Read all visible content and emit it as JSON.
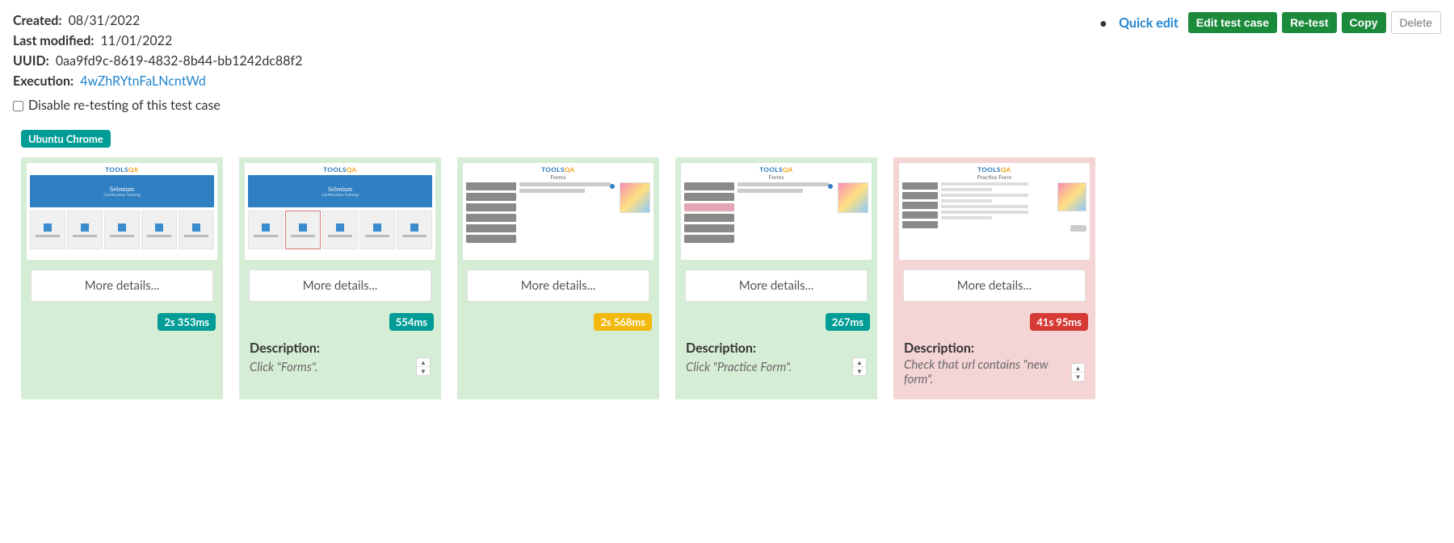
{
  "meta": {
    "created_label": "Created:",
    "created_value": "08/31/2022",
    "modified_label": "Last modified:",
    "modified_value": "11/01/2022",
    "uuid_label": "UUID:",
    "uuid_value": "0aa9fd9c-8619-4832-8b44-bb1242dc88f2",
    "execution_label": "Execution:",
    "execution_value": "4wZhRYtnFaLNcntWd",
    "disable_label": "Disable re-testing of this test case"
  },
  "actions": {
    "quick_edit": "Quick edit",
    "edit": "Edit test case",
    "retest": "Re-test",
    "copy": "Copy",
    "delete": "Delete"
  },
  "env_badge": "Ubuntu Chrome",
  "cards": [
    {
      "status": "green",
      "thumb_variant": "a",
      "thumb_active_tile": false,
      "more": "More details...",
      "time": "2s 353ms",
      "time_color": "teal",
      "has_desc": false
    },
    {
      "status": "green",
      "thumb_variant": "a",
      "thumb_active_tile": true,
      "more": "More details...",
      "time": "554ms",
      "time_color": "teal",
      "has_desc": true,
      "desc_label": "Description:",
      "desc_text": "Click \"Forms\"."
    },
    {
      "status": "green",
      "thumb_variant": "b",
      "thumb_page_title": "Forms",
      "more": "More details...",
      "time": "2s 568ms",
      "time_color": "yellow",
      "has_desc": false
    },
    {
      "status": "green",
      "thumb_variant": "b",
      "thumb_page_title": "Forms",
      "thumb_pink_item": true,
      "more": "More details...",
      "time": "267ms",
      "time_color": "teal",
      "has_desc": true,
      "desc_label": "Description:",
      "desc_text": "Click \"Practice Form\"."
    },
    {
      "status": "red",
      "thumb_variant": "c",
      "thumb_page_title": "Practice Form",
      "more": "More details...",
      "time": "41s 95ms",
      "time_color": "red",
      "has_desc": true,
      "desc_label": "Description:",
      "desc_text": "Check that url contains \"new form\"."
    }
  ],
  "thumb_text": {
    "logo_tools": "TOOLS",
    "logo_qa": "QA",
    "selenium": "Selenium",
    "selenium_sub": "Certification Training"
  }
}
